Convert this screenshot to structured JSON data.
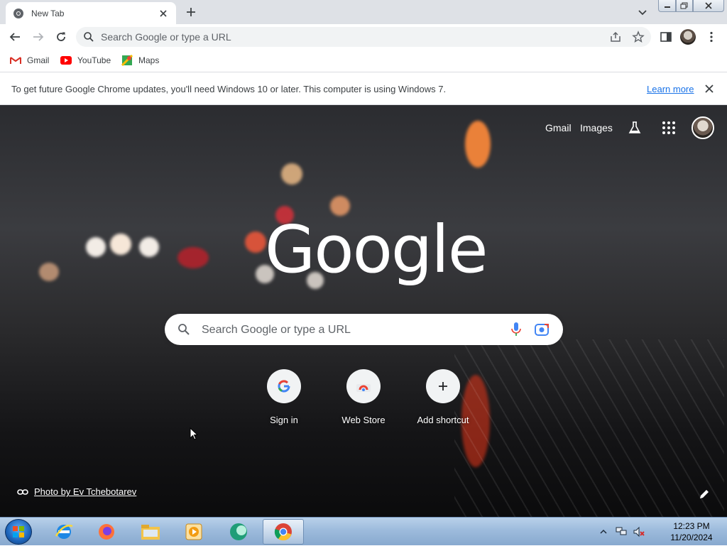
{
  "browser": {
    "tab": {
      "title": "New Tab"
    },
    "omnibox": {
      "placeholder": "Search Google or type a URL"
    },
    "bookmarks": [
      {
        "label": "Gmail",
        "icon": "gmail-icon"
      },
      {
        "label": "YouTube",
        "icon": "youtube-icon"
      },
      {
        "label": "Maps",
        "icon": "maps-icon"
      }
    ]
  },
  "infobar": {
    "message": "To get future Google Chrome updates, you'll need Windows 10 or later. This computer is using Windows 7.",
    "link": "Learn more"
  },
  "ntp": {
    "links": {
      "gmail": "Gmail",
      "images": "Images"
    },
    "logo": "Google",
    "search_placeholder": "Search Google or type a URL",
    "shortcuts": [
      {
        "label": "Sign in",
        "icon": "google-g-icon"
      },
      {
        "label": "Web Store",
        "icon": "chrome-web-store-icon"
      },
      {
        "label": "Add shortcut",
        "icon": "plus-icon"
      }
    ],
    "attribution": "Photo by Ev Tchebotarev"
  },
  "taskbar": {
    "apps": [
      "internet-explorer-icon",
      "firefox-icon",
      "file-explorer-icon",
      "media-player-icon",
      "app-icon",
      "chrome-icon"
    ],
    "clock": {
      "time": "12:23 PM",
      "date": "11/20/2024"
    }
  },
  "colors": {
    "tabstrip": "#dee1e6",
    "link": "#1a73e8",
    "taskbar": "#9dbbdc"
  }
}
